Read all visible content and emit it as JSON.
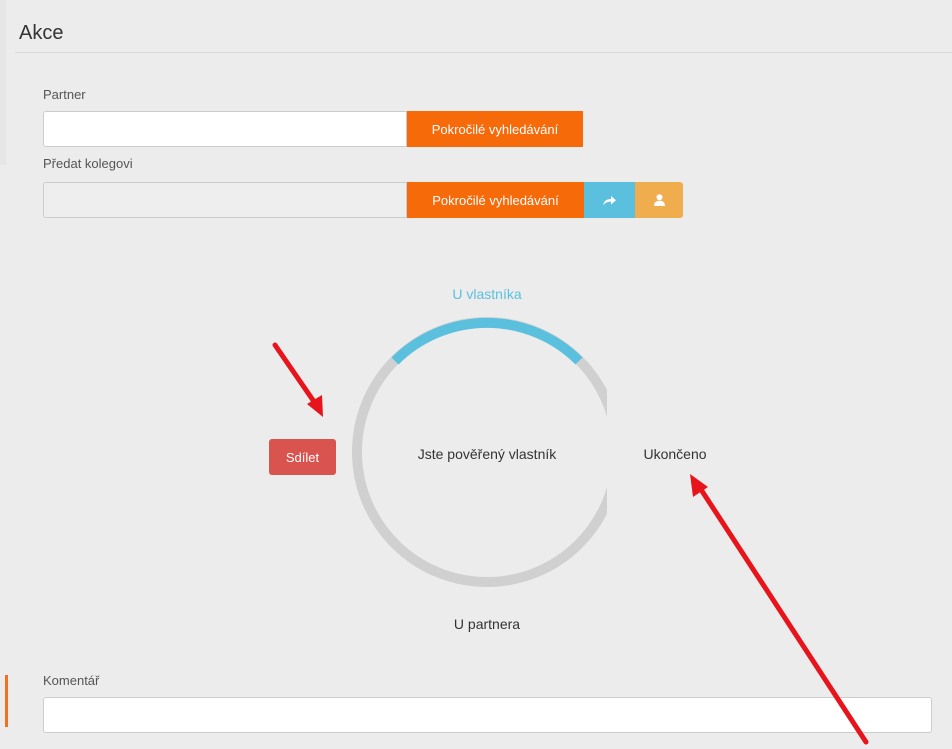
{
  "page": {
    "title": "Akce"
  },
  "partner": {
    "label": "Partner",
    "value": "",
    "search_button": "Pokročilé vyhledávání"
  },
  "colleague": {
    "label": "Předat kolegovi",
    "value": "",
    "search_button": "Pokročilé vyhledávání",
    "forward_icon": "share-arrow-icon",
    "user_icon": "user-icon"
  },
  "workflow": {
    "state_top": "U vlastníka",
    "state_right": "Ukončeno",
    "state_bottom": "U partnera",
    "center_text": "Jste pověřený vlastník",
    "share_button": "Sdílet",
    "active_arc_color": "#5bc0de",
    "ring_color": "#d0d0d0"
  },
  "comment": {
    "label": "Komentář",
    "value": ""
  },
  "colors": {
    "orange": "#f66a0a",
    "blue": "#5bc0de",
    "amber": "#f0ad4e",
    "red": "#d9534f",
    "annotation_arrow": "#e8141b"
  }
}
